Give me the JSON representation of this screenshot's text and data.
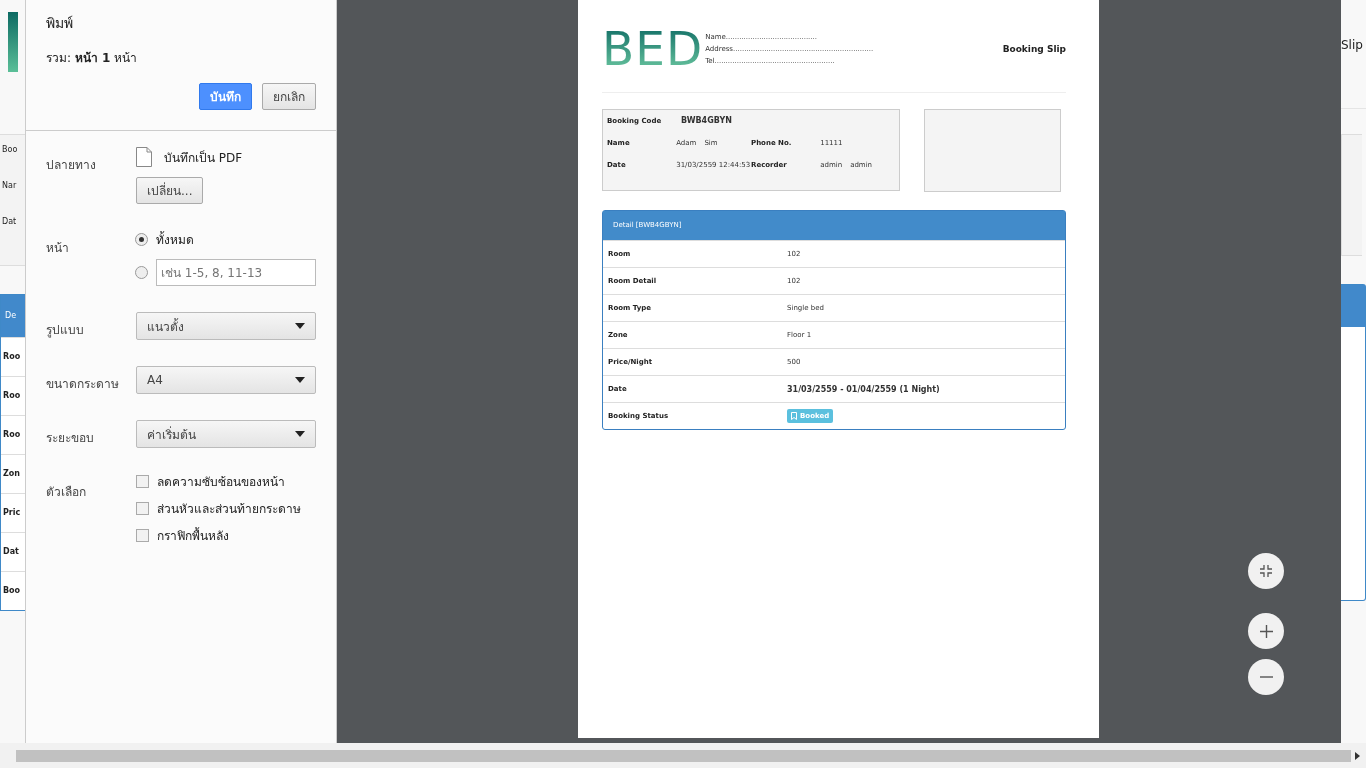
{
  "background_page": {
    "left_edge": [
      "Boo",
      "Nar",
      "Dat",
      "De",
      "Roo",
      "Roo",
      "Roo",
      "Zon",
      "Pric",
      "Dat",
      "Boo"
    ],
    "right_edge": [
      "Slip"
    ]
  },
  "print_dialog": {
    "title": "พิมพ์",
    "summary": "รวม: **หน้า 1** หน้า",
    "buttons": [
      {
        "label": "บันทึก",
        "kind": "primary"
      },
      {
        "label": "ยกเลิก",
        "kind": "secondary"
      }
    ],
    "destination": {
      "label": "ปลายทาง",
      "printer": "บันทึกเป็น PDF",
      "change_button": "เปลี่ยน..."
    },
    "pages": {
      "label": "หน้า",
      "options": [
        {
          "kind": "all",
          "label": "ทั้งหมด",
          "selected": true
        },
        {
          "kind": "range",
          "placeholder": "เช่น 1-5, 8, 11-13",
          "selected": false
        }
      ]
    },
    "selects": [
      {
        "label": "รูปแบบ",
        "value": "แนวตั้ง"
      },
      {
        "label": "ขนาดกระดาษ",
        "value": "A4"
      },
      {
        "label": "ระยะขอบ",
        "value": "ค่าเริ่มต้น"
      }
    ],
    "options": {
      "label": "ตัวเลือก",
      "checkboxes": [
        {
          "label": "ลดความซับซ้อนของหน้า",
          "checked": false
        },
        {
          "label": "ส่วนหัวและส่วนท้ายกระดาษ",
          "checked": false
        },
        {
          "label": "กราฟิกพื้นหลัง",
          "checked": false
        }
      ]
    }
  },
  "preview": {
    "logo": "BED",
    "contact_lines": [
      "Name.........................................",
      "Address...............................................................",
      "Tel......................................................"
    ],
    "doc_title": "Booking Slip",
    "info": [
      [
        {
          "label": "Booking Code",
          "value": [
            "BWB4GBYN"
          ],
          "kind": "code"
        }
      ],
      [
        {
          "label": "Name",
          "value": [
            "Adam",
            "Sim"
          ]
        },
        {
          "label": "Phone No.",
          "value": [
            "11111"
          ]
        }
      ],
      [
        {
          "label": "Date",
          "value": [
            "31/03/2559 12:44:53"
          ]
        },
        {
          "label": "Recorder",
          "value": [
            "admin",
            "admin"
          ]
        }
      ]
    ],
    "detail": {
      "title": "Detail [BWB4GBYN]",
      "rows": [
        {
          "label": "Room",
          "value": "102"
        },
        {
          "label": "Room Detail",
          "value": "102"
        },
        {
          "label": "Room Type",
          "value": "Single bed"
        },
        {
          "label": "Zone",
          "value": "Floor 1"
        },
        {
          "label": "Price/Night",
          "value": "500"
        },
        {
          "label": "Date",
          "value": "31/03/2559 - 01/04/2559 (1 Night)",
          "kind": "bold"
        },
        {
          "label": "Booking Status",
          "value": "Booked",
          "kind": "badge"
        }
      ]
    }
  }
}
